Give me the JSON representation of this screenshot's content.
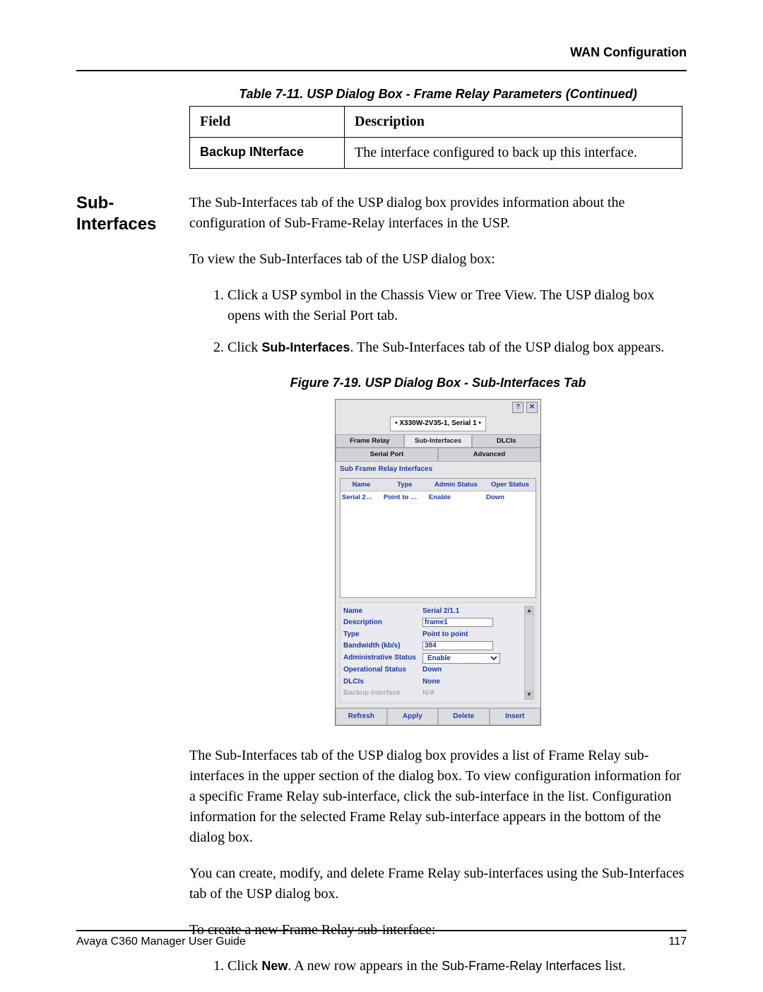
{
  "header": "WAN Configuration",
  "table": {
    "caption": "Table 7-11.  USP Dialog Box - Frame Relay Parameters (Continued)",
    "col1": "Field",
    "col2": "Description",
    "row1_field": "Backup INterface",
    "row1_desc": "The interface configured to back up this interface."
  },
  "section_label": "Sub-Interfaces",
  "para1": "The Sub-Interfaces tab of the USP dialog box provides information about the configuration of Sub-Frame-Relay interfaces in the USP.",
  "para2": "To view the Sub-Interfaces tab of the USP dialog box:",
  "steps_a": {
    "s1": "Click a USP symbol in the Chassis View or Tree View. The USP dialog box opens with the Serial Port tab.",
    "s2_prefix": "Click ",
    "s2_bold": "Sub-Interfaces",
    "s2_suffix": ". The Sub-Interfaces tab of the USP dialog box appears."
  },
  "figure_caption": "Figure 7-19.  USP Dialog Box - Sub-Interfaces Tab",
  "dialog": {
    "crumb": "• X330W-2V35-1, Serial 1 •",
    "tabs": {
      "frame_relay": "Frame Relay",
      "sub_interfaces": "Sub-Interfaces",
      "dlcis": "DLCIs",
      "serial_port": "Serial Port",
      "advanced": "Advanced"
    },
    "panel_title": "Sub Frame Relay Interfaces",
    "thead": {
      "name": "Name",
      "type": "Type",
      "admin": "Admin Status",
      "oper": "Oper Status"
    },
    "trow": {
      "name": "Serial 2…",
      "type": "Point to …",
      "admin": "Enable",
      "oper": "Down"
    },
    "detail": {
      "name_lbl": "Name",
      "name_val": "Serial 2/1.1",
      "desc_lbl": "Description",
      "desc_val": "frame1",
      "type_lbl": "Type",
      "type_val": "Point to point",
      "bw_lbl": "Bandwidth (kb/s)",
      "bw_val": "384",
      "admin_lbl": "Administrative Status",
      "admin_val": "Enable",
      "oper_lbl": "Operational Status",
      "oper_val": "Down",
      "dlcis_lbl": "DLCIs",
      "dlcis_val": "None",
      "backup_lbl": "Backup Interface",
      "backup_val": "N/A"
    },
    "buttons": {
      "refresh": "Refresh",
      "apply": "Apply",
      "delete": "Delete",
      "insert": "Insert"
    }
  },
  "para3": "The Sub-Interfaces tab of the USP dialog box provides a list of Frame Relay sub-interfaces in the upper section of the dialog box. To view configuration information for a specific Frame Relay sub-interface, click the sub-interface in the list. Configuration information for the selected Frame Relay sub-interface appears in the bottom of the dialog box.",
  "para4": "You can create, modify, and delete Frame Relay sub-interfaces using the Sub-Interfaces tab of the USP dialog box.",
  "para5": "To create a new Frame Relay sub-interface:",
  "steps_b": {
    "s1_prefix": "Click ",
    "s1_bold": "New",
    "s1_mid": ". A new row appears in the ",
    "s1_sans": "Sub-Frame-Relay Interfaces",
    "s1_suffix": " list."
  },
  "footer": {
    "left": "Avaya C360 Manager User Guide",
    "right": "117"
  }
}
